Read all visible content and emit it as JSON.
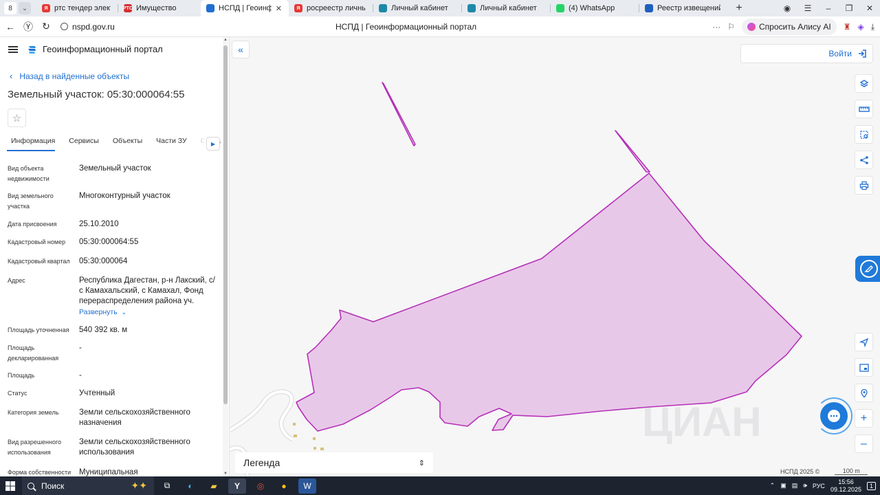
{
  "browser": {
    "tab_counter": "8",
    "tabs": [
      {
        "title": "ртс тендер электронная",
        "fav_color": "#e53935",
        "fav_text": "Я",
        "active": false
      },
      {
        "title": "Имущество",
        "fav_color": "#d32f2f",
        "fav_text": "РТС",
        "active": false
      },
      {
        "title": "НСПД | Геоинформаци",
        "fav_color": "#1f6fd1",
        "fav_text": "",
        "active": true
      },
      {
        "title": "росреестр личный каби",
        "fav_color": "#e53935",
        "fav_text": "Я",
        "active": false
      },
      {
        "title": "Личный кабинет",
        "fav_color": "#1e88a8",
        "fav_text": "",
        "active": false
      },
      {
        "title": "Личный кабинет",
        "fav_color": "#1e88a8",
        "fav_text": "",
        "active": false
      },
      {
        "title": "(4) WhatsApp",
        "fav_color": "#25d366",
        "fav_text": "",
        "active": false
      },
      {
        "title": "Реестр извещений",
        "fav_color": "#1f5fbf",
        "fav_text": "",
        "active": false
      }
    ],
    "tab_close": "✕",
    "url": "nspd.gov.ru",
    "page_title": "НСПД | Геоинформационный портал",
    "alice_label": "Спросить Алису AI"
  },
  "panel": {
    "portal_title": "Геоинформационный портал",
    "back_link": "Назад в найденные объекты",
    "object_title": "Земельный участок: 05:30:000064:55",
    "tabs": [
      "Информация",
      "Сервисы",
      "Объекты",
      "Части ЗУ",
      "Соста"
    ],
    "properties": [
      {
        "key": "Вид объекта недвижимости",
        "value": "Земельный участок"
      },
      {
        "key": "Вид земельного участка",
        "value": "Многоконтурный участок"
      },
      {
        "key": "Дата присвоения",
        "value": "25.10.2010"
      },
      {
        "key": "Кадастровый номер",
        "value": "05:30:000064:55"
      },
      {
        "key": "Кадастровый квартал",
        "value": "05:30:000064"
      },
      {
        "key": "Адрес",
        "value": "Республика Дагестан, р-н Лакский, с/с Камахальский, с Камахал, Фонд перераспределения района уч."
      },
      {
        "key": "Площадь уточненная",
        "value": "540 392 кв. м"
      },
      {
        "key": "Площадь декларированная",
        "value": "-"
      },
      {
        "key": "Площадь",
        "value": "-"
      },
      {
        "key": "Статус",
        "value": "Учтенный"
      },
      {
        "key": "Категория земель",
        "value": "Земли сельскохозяйственного назначения"
      },
      {
        "key": "Вид разрешенного использования",
        "value": "Земли сельскохозяйственного использования"
      },
      {
        "key": "Форма собственности",
        "value": "Муниципальная"
      }
    ],
    "expand_label": "Развернуть"
  },
  "map": {
    "login_label": "Войти",
    "legend_label": "Легенда",
    "copyright": "НСПД 2025 ©",
    "scale_label": "100 m",
    "watermark": "ЦИАН",
    "parcel_fill": "#e8c8e8",
    "parcel_stroke": "#b52fb8"
  },
  "taskbar": {
    "search_label": "Поиск",
    "lang": "РУС",
    "time": "15:56",
    "date": "09.12.2025",
    "notification_count": "1"
  }
}
